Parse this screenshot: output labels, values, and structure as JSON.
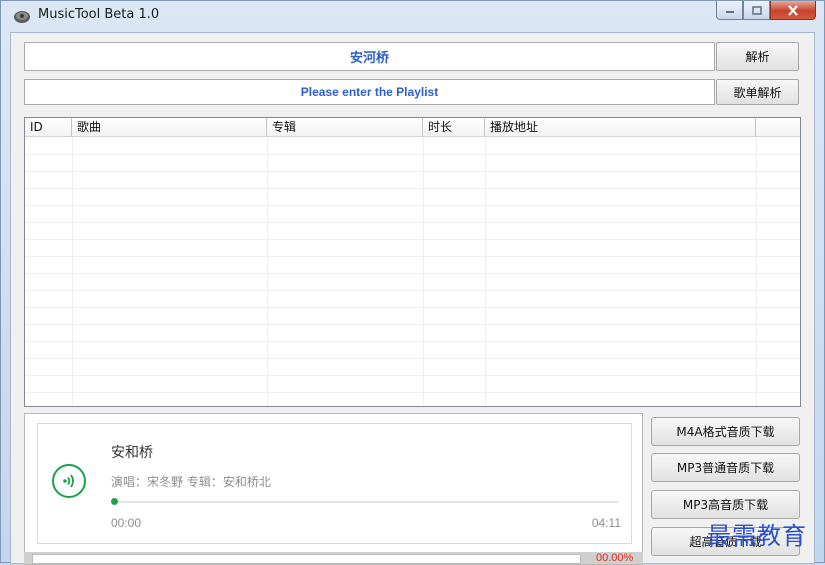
{
  "window": {
    "title": "MusicTool Beta 1.0"
  },
  "search": {
    "song_value": "安河桥",
    "parse_label": "解析"
  },
  "playlist": {
    "placeholder": "Please enter the Playlist",
    "parse_label": "歌单解析"
  },
  "table": {
    "columns": [
      "ID",
      "歌曲",
      "专辑",
      "时长",
      "播放地址"
    ],
    "rows": []
  },
  "player": {
    "song_title": "安和桥",
    "meta": "演唱：宋冬野 专辑：安和桥北",
    "current_time": "00:00",
    "total_time": "04:11",
    "progress_fraction": 0
  },
  "downloads": {
    "m4a_label": "M4A格式音质下载",
    "mp3_normal_label": "MP3普通音质下载",
    "mp3_high_label": "MP3高音质下载",
    "super_label": "超高音质下载",
    "percent": "00.00%"
  },
  "watermark": "最需教育",
  "colors": {
    "accent": "#2e5ec9",
    "play_green": "#1aa34a",
    "percent_red": "#d9301f"
  }
}
